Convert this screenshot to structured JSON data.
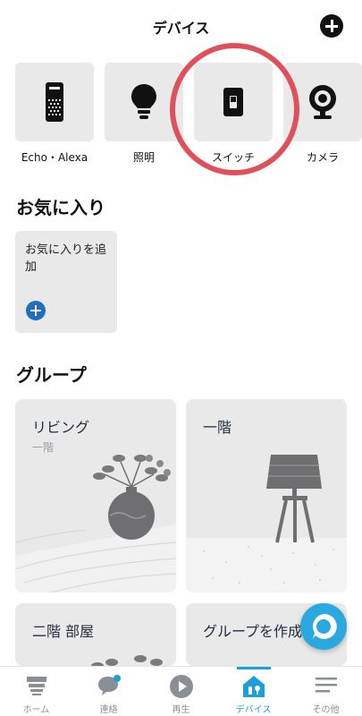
{
  "header": {
    "title": "デバイス"
  },
  "categories": [
    {
      "label": "Echo・Alexa",
      "icon": "echo-speaker-icon"
    },
    {
      "label": "照明",
      "icon": "light-bulb-icon"
    },
    {
      "label": "スイッチ",
      "icon": "light-switch-icon"
    },
    {
      "label": "カメラ",
      "icon": "camera-icon"
    }
  ],
  "favorites": {
    "title": "お気に入り",
    "add_label": "お気に入りを追加"
  },
  "groups": {
    "title": "グループ",
    "items": [
      {
        "name": "リビング",
        "sub": "一階"
      },
      {
        "name": "一階",
        "sub": ""
      },
      {
        "name": "二階 部屋",
        "sub": ""
      },
      {
        "name": "グループを作成",
        "sub": ""
      }
    ]
  },
  "tabs": [
    {
      "label": "ホーム",
      "icon": "home-icon"
    },
    {
      "label": "連絡",
      "icon": "chat-icon"
    },
    {
      "label": "再生",
      "icon": "play-icon"
    },
    {
      "label": "デバイス",
      "icon": "devices-icon",
      "active": true
    },
    {
      "label": "その他",
      "icon": "menu-icon"
    }
  ],
  "colors": {
    "accent": "#1aa0d8",
    "alexa": "#2aa8e0",
    "highlight_ring": "#e0505a",
    "tile_bg": "#e9e9ea",
    "plus_blue": "#1e6fbe"
  }
}
